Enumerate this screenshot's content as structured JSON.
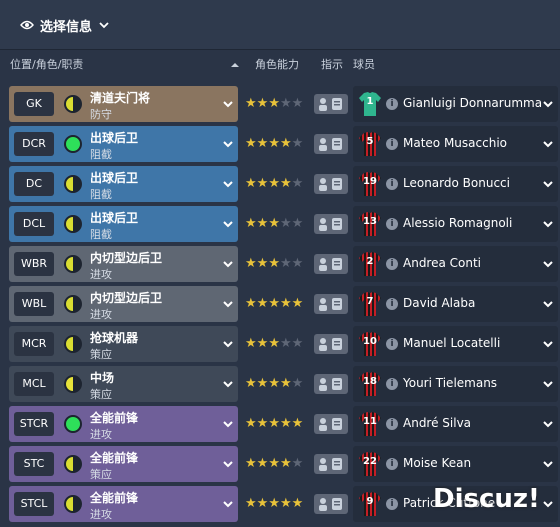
{
  "header": {
    "selection_label": "选择信息"
  },
  "columns": {
    "position_role_duty": "位置/角色/职责",
    "role_ability": "角色能力",
    "instructions": "指示",
    "player": "球员"
  },
  "colors": {
    "gk": "#8a7560",
    "def": "#3f76a8",
    "wb": "#5f6773",
    "mid": "#3f4958",
    "att": "#6f5f99",
    "defend": "#e6e23a",
    "support": "#d9dd32",
    "attack": "#2ee05a",
    "star": "#e8c23a"
  },
  "rows": [
    {
      "pos": "GK",
      "role": "清道夫门将",
      "duty": "防守",
      "group": "gk",
      "indicator": "support",
      "stars": 3,
      "half": false,
      "shirt": "keeper",
      "number": "1",
      "player": "Gianluigi Donnarumma"
    },
    {
      "pos": "DCR",
      "role": "出球后卫",
      "duty": "阻截",
      "group": "def",
      "indicator": "attack",
      "stars": 3,
      "half": true,
      "shirt": "outfield",
      "number": "5",
      "player": "Mateo Musacchio"
    },
    {
      "pos": "DC",
      "role": "出球后卫",
      "duty": "阻截",
      "group": "def",
      "indicator": "support",
      "stars": 4,
      "half": false,
      "shirt": "outfield",
      "number": "19",
      "player": "Leonardo Bonucci"
    },
    {
      "pos": "DCL",
      "role": "出球后卫",
      "duty": "阻截",
      "group": "def",
      "indicator": "support",
      "stars": 3,
      "half": false,
      "shirt": "outfield",
      "number": "13",
      "player": "Alessio Romagnoli"
    },
    {
      "pos": "WBR",
      "role": "内切型边后卫",
      "duty": "进攻",
      "group": "wb",
      "indicator": "support",
      "stars": 3,
      "half": false,
      "shirt": "outfield",
      "number": "2",
      "player": "Andrea Conti"
    },
    {
      "pos": "WBL",
      "role": "内切型边后卫",
      "duty": "进攻",
      "group": "wb",
      "indicator": "support",
      "stars": 4,
      "half": true,
      "shirt": "outfield",
      "number": "7",
      "player": "David Alaba"
    },
    {
      "pos": "MCR",
      "role": "抢球机器",
      "duty": "策应",
      "group": "mid",
      "indicator": "support",
      "stars": 3,
      "half": false,
      "shirt": "outfield",
      "number": "10",
      "player": "Manuel Locatelli"
    },
    {
      "pos": "MCL",
      "role": "中场",
      "duty": "策应",
      "group": "mid",
      "indicator": "defend",
      "stars": 3,
      "half": true,
      "shirt": "outfield",
      "number": "18",
      "player": "Youri Tielemans"
    },
    {
      "pos": "STCR",
      "role": "全能前锋",
      "duty": "进攻",
      "group": "att",
      "indicator": "attack",
      "stars": 4,
      "half": true,
      "shirt": "outfield",
      "number": "11",
      "player": "André Silva"
    },
    {
      "pos": "STC",
      "role": "全能前锋",
      "duty": "策应",
      "group": "att",
      "indicator": "support",
      "stars": 4,
      "half": false,
      "shirt": "outfield",
      "number": "22",
      "player": "Moise Kean"
    },
    {
      "pos": "STCL",
      "role": "全能前锋",
      "duty": "进攻",
      "group": "att",
      "indicator": "support",
      "stars": 4,
      "half": true,
      "shirt": "outfield",
      "number": "9",
      "player": "Patrick Cutrone"
    }
  ],
  "watermark": "Discuz!"
}
